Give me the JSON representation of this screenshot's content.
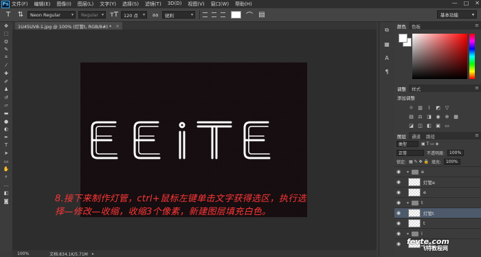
{
  "menubar": {
    "logo": "Ps",
    "items": [
      "文件(F)",
      "编辑(E)",
      "图像(I)",
      "图层(L)",
      "文字(Y)",
      "选择(S)",
      "滤镜(T)",
      "3D(D)",
      "视图(V)",
      "窗口(W)",
      "帮助(H)"
    ],
    "window_controls": [
      "—",
      "□",
      "✕"
    ]
  },
  "options": {
    "font_family": "Neon Regular",
    "font_style": "Regular",
    "font_size": "120 点",
    "aa_label": "aa",
    "antialias": "锐利",
    "text_color": "#ffffff",
    "workspace": "基本功能"
  },
  "document": {
    "tab_title": "1U45UV8-1.jpg @ 100% (灯管t, RGB/8#) *",
    "tab_close": "×",
    "neon_text": "EEITE",
    "caption_line1": "8.接下来制作灯管，ctrl+鼠标左键单击文字获得选区，执行选",
    "caption_line2": "择—修改—收缩，收缩3个像素，新建图层填充白色。"
  },
  "status": {
    "zoom": "100%",
    "doc_info": "文档:834.1K/5.71M",
    "arrow": "▸"
  },
  "color_panel": {
    "tabs": [
      "颜色",
      "色板"
    ],
    "foreground": "#ffffff",
    "background": "#ffffff"
  },
  "adjust_panel": {
    "tabs": [
      "调整",
      "样式"
    ],
    "title": "添加调整"
  },
  "layers_panel": {
    "tabs": [
      "图层",
      "通道",
      "路径"
    ],
    "filter": "类型",
    "blend_mode": "正常",
    "opacity_label": "不透明度:",
    "opacity": "100%",
    "lock_label": "锁定:",
    "fill_label": "填充:",
    "fill": "100%",
    "rows": [
      {
        "name": "e",
        "type": "group",
        "selected": false
      },
      {
        "name": "灯管e",
        "type": "layer",
        "selected": false
      },
      {
        "name": "e",
        "type": "layer",
        "selected": false
      },
      {
        "name": "t",
        "type": "group",
        "selected": false
      },
      {
        "name": "灯管t",
        "type": "layer",
        "selected": true
      },
      {
        "name": "t",
        "type": "layer",
        "selected": false
      },
      {
        "name": "i",
        "type": "group",
        "selected": false
      },
      {
        "name": "灯管i",
        "type": "layer",
        "selected": false
      }
    ]
  },
  "watermark": {
    "line1": "fevte.com",
    "line2": "飞特教程网"
  }
}
